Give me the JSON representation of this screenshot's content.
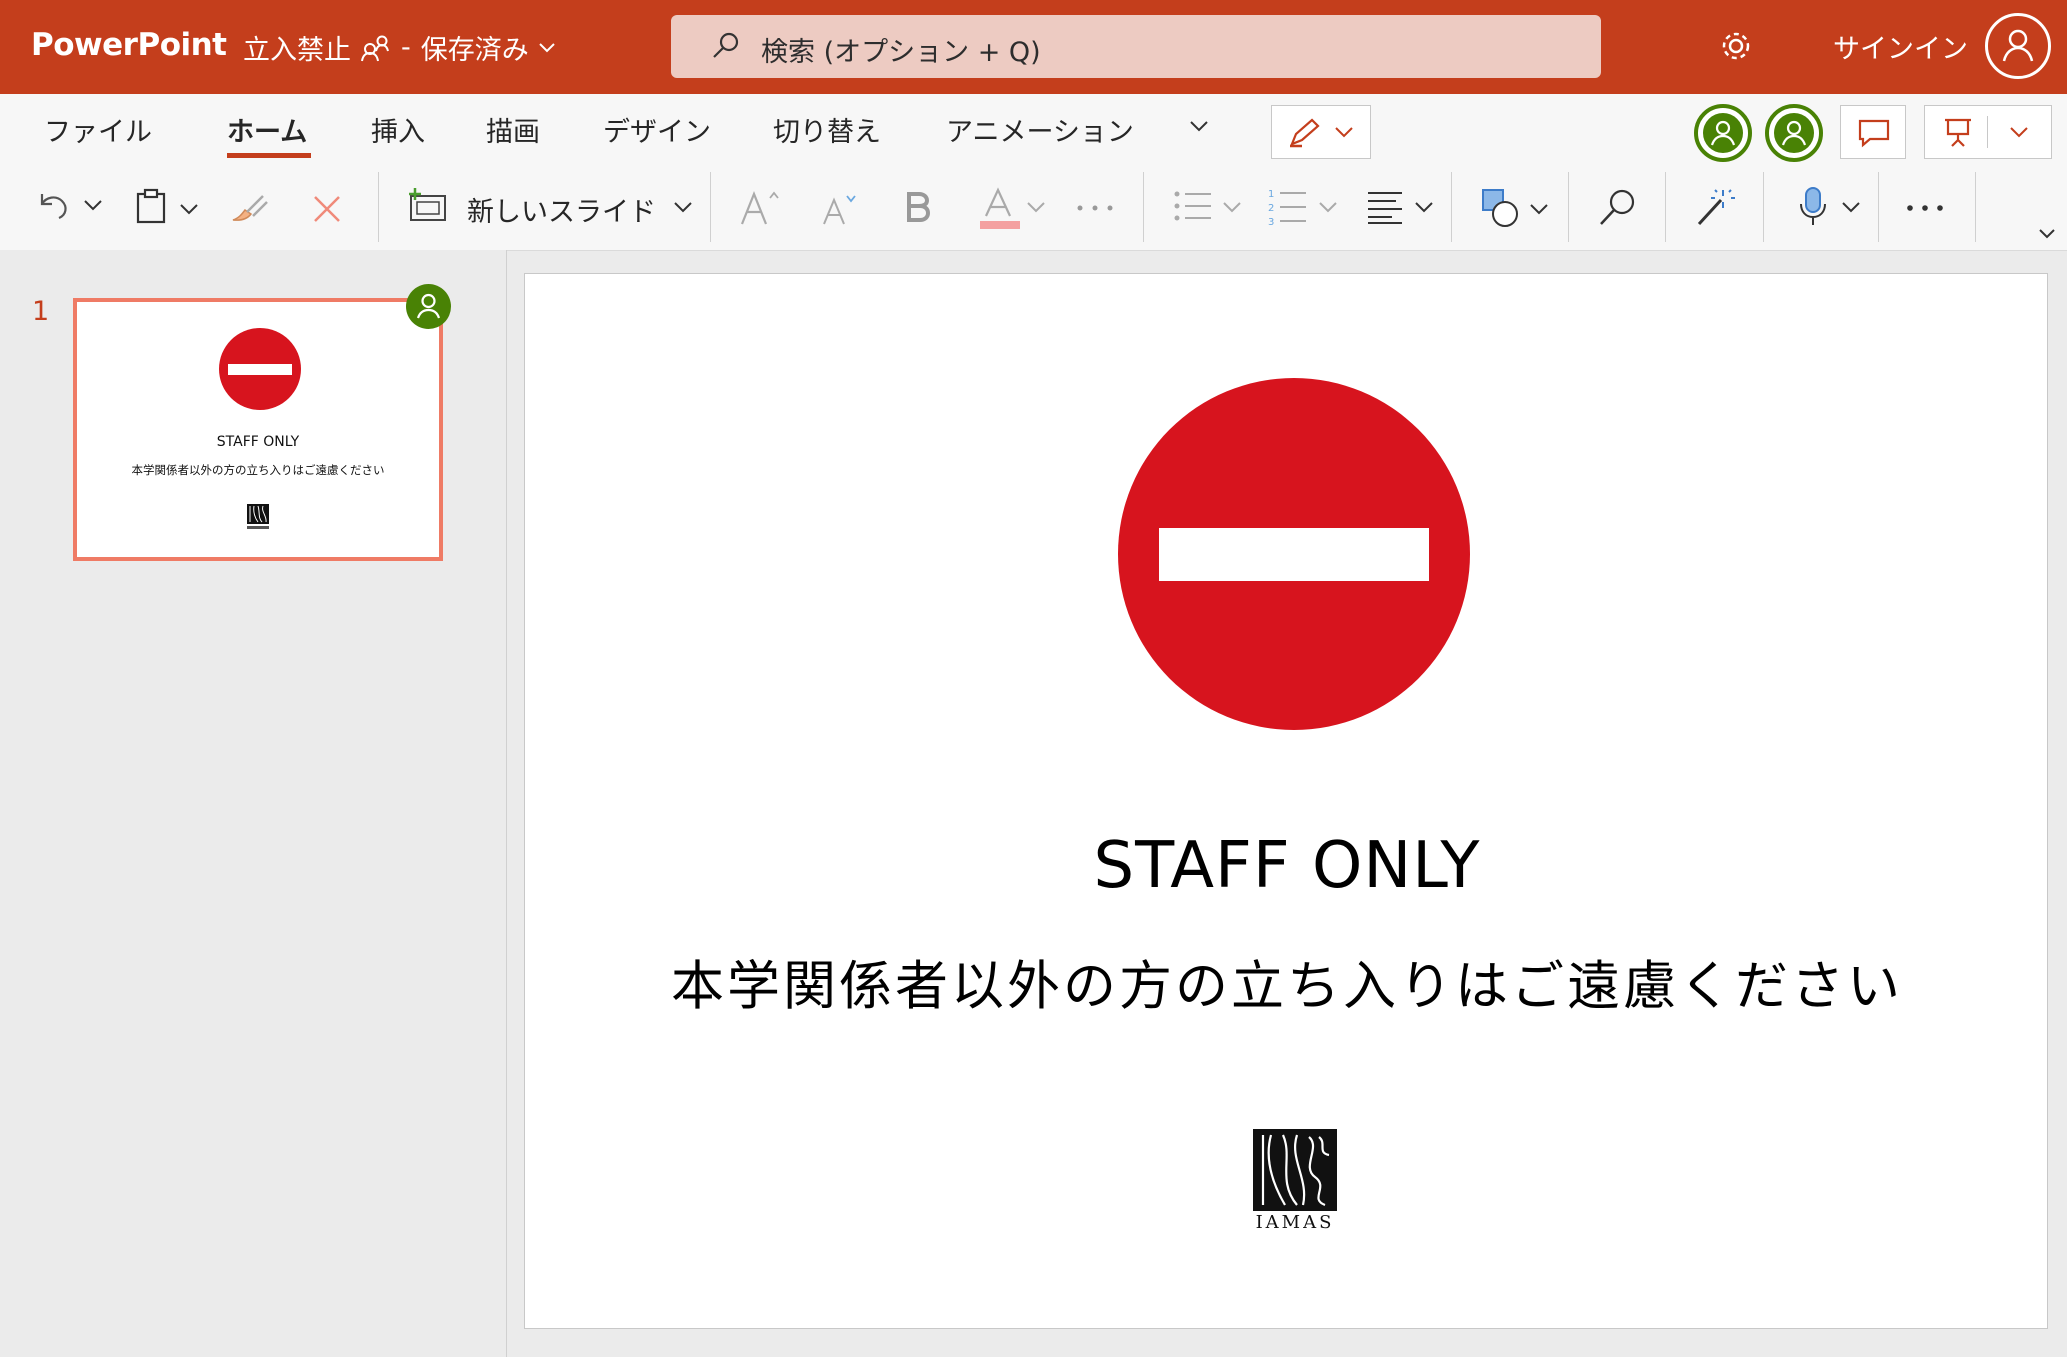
{
  "titlebar": {
    "app_name": "PowerPoint",
    "doc_title": "立入禁止",
    "separator": "-",
    "save_status": "保存済み",
    "search_placeholder": "検索 (オプション + Q)",
    "signin_label": "サインイン"
  },
  "ribbon": {
    "tabs": [
      {
        "label": "ファイル"
      },
      {
        "label": "ホーム"
      },
      {
        "label": "挿入"
      },
      {
        "label": "描画"
      },
      {
        "label": "デザイン"
      },
      {
        "label": "切り替え"
      },
      {
        "label": "アニメーション"
      }
    ],
    "active_tab": "ホーム",
    "new_slide_label": "新しいスライド"
  },
  "slide_panel": {
    "slide_number": "1"
  },
  "slide": {
    "title": "STAFF ONLY",
    "subtitle": "本学関係者以外の方の立ち入りはご遠慮ください",
    "logo_text": "IAMAS"
  },
  "colors": {
    "brand": "#c43e1c",
    "sign_red": "#d7141e",
    "collaborator_green": "#498205",
    "thumb_selected_border": "#ef7b65"
  },
  "icons": [
    "search-icon",
    "gear-icon",
    "avatar-icon",
    "undo-icon",
    "paste-icon",
    "format-painter-icon",
    "delete-icon",
    "new-slide-icon",
    "font-grow-icon",
    "font-shrink-icon",
    "bold-icon",
    "font-color-icon",
    "more-icon",
    "bullets-icon",
    "numbering-icon",
    "align-icon",
    "shapes-icon",
    "find-icon",
    "designer-icon",
    "dictate-icon",
    "pen-icon",
    "comment-icon",
    "present-icon"
  ]
}
